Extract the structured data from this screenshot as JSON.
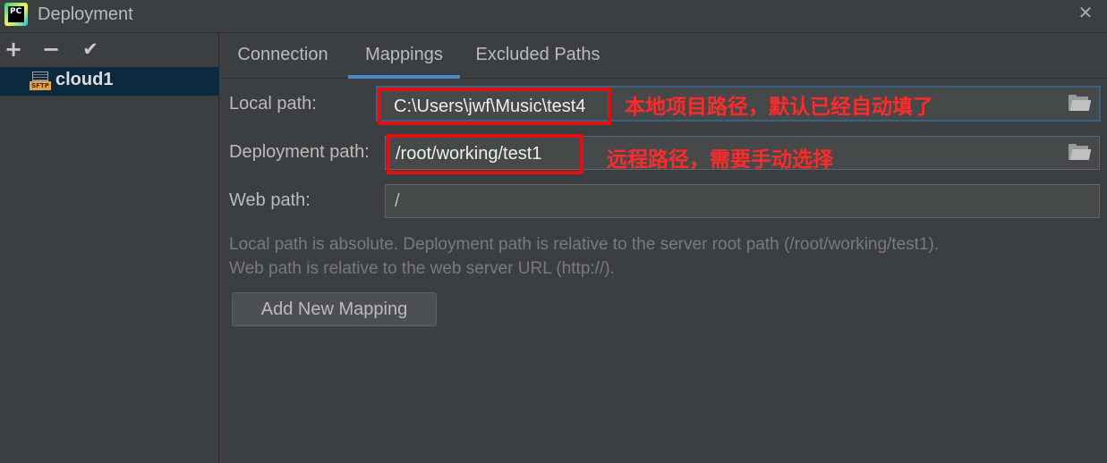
{
  "window": {
    "title": "Deployment",
    "close_glyph": "✕",
    "app_icon": "pycharm-icon",
    "app_icon_text": "PC"
  },
  "toolbar": {
    "add_glyph": "+",
    "remove_glyph": "−",
    "default_glyph": "✔"
  },
  "servers": [
    {
      "name": "cloud1",
      "icon": "sftp-server-icon",
      "icon_text": "SFTP",
      "selected": true
    }
  ],
  "tabs": [
    {
      "label": "Connection",
      "active": false
    },
    {
      "label": "Mappings",
      "active": true
    },
    {
      "label": "Excluded Paths",
      "active": false
    }
  ],
  "mappings": {
    "local_path_label": "Local path:",
    "local_path_value": "C:\\Users\\jwf\\Music\\test4",
    "deployment_path_label": "Deployment path:",
    "deployment_path_value": "/root/working/test1",
    "web_path_label": "Web path:",
    "web_path_value": "/",
    "hint_line1": "Local path is absolute. Deployment path is relative to the server root path (/root/working/test1).",
    "hint_line2": "Web path is relative to the web server URL (http://).",
    "add_button": "Add New Mapping"
  },
  "annotations": {
    "local_note": "本地项目路径，默认已经自动填了",
    "remote_note": "远程路径，需要手动选择",
    "color": "#ff2a2a"
  },
  "colors": {
    "background": "#3c3f41",
    "selection": "#0d293e",
    "tab_underline": "#4a88c7",
    "highlight_box": "#e01010"
  }
}
